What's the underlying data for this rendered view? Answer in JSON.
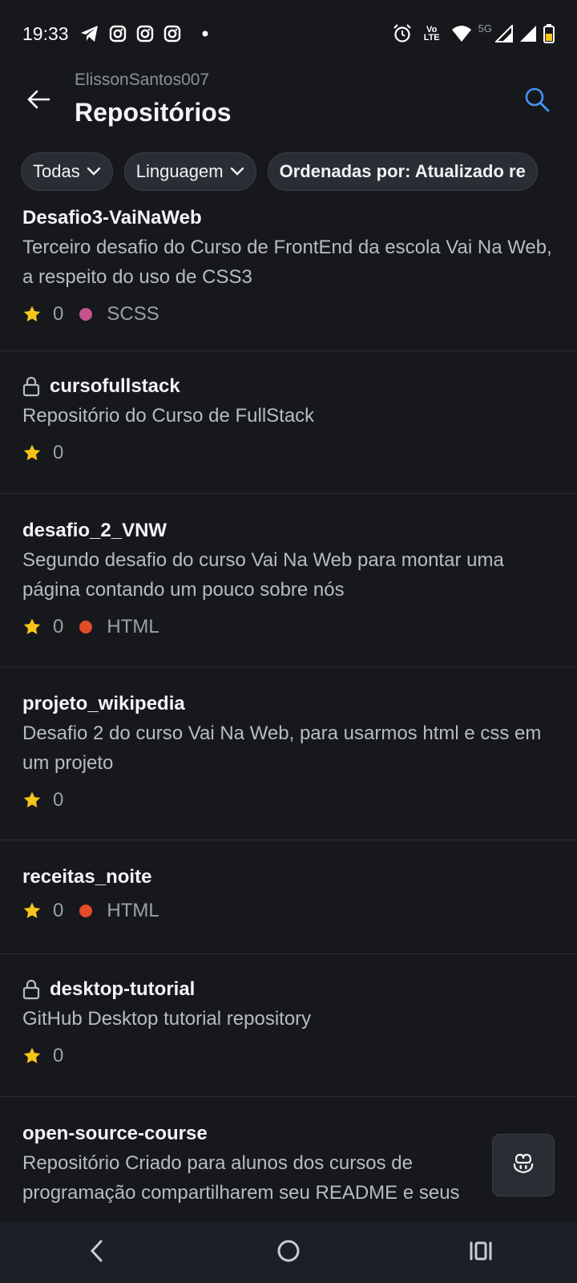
{
  "status_bar": {
    "time": "19:33",
    "left_icons": [
      "telegram-icon",
      "instagram-icon",
      "instagram-icon",
      "instagram-icon",
      "dot-icon"
    ],
    "volte_top": "Vo",
    "volte_bottom": "LTE",
    "network": "5G",
    "right_icons": [
      "alarm-icon",
      "volte-icon",
      "wifi-icon",
      "signal-icon",
      "signal-icon",
      "battery-icon"
    ]
  },
  "header": {
    "owner": "ElissonSantos007",
    "title": "Repositórios"
  },
  "filters": [
    {
      "label": "Todas",
      "has_chevron": true
    },
    {
      "label": "Linguagem",
      "has_chevron": true
    },
    {
      "label": "Ordenadas por: Atualizado re",
      "has_chevron": false
    }
  ],
  "repos": [
    {
      "name": "Desafio3-VaiNaWeb",
      "private": false,
      "description": "Terceiro desafio do Curso de FrontEnd da escola Vai Na Web, a respeito do uso de CSS3",
      "stars": "0",
      "language": "SCSS",
      "language_color": "#c6538c"
    },
    {
      "name": "cursofullstack",
      "private": true,
      "description": "Repositório do Curso de FullStack",
      "stars": "0",
      "language": "",
      "language_color": ""
    },
    {
      "name": "desafio_2_VNW",
      "private": false,
      "description": "Segundo desafio do curso Vai Na Web para montar uma página contando um pouco sobre nós",
      "stars": "0",
      "language": "HTML",
      "language_color": "#e34c26"
    },
    {
      "name": "projeto_wikipedia",
      "private": false,
      "description": "Desafio 2 do curso Vai Na Web, para usarmos html e css em um projeto",
      "stars": "0",
      "language": "",
      "language_color": ""
    },
    {
      "name": "receitas_noite",
      "private": false,
      "description": "",
      "stars": "0",
      "language": "HTML",
      "language_color": "#e34c26"
    },
    {
      "name": "desktop-tutorial",
      "private": true,
      "description": "GitHub Desktop tutorial repository",
      "stars": "0",
      "language": "",
      "language_color": ""
    },
    {
      "name": "open-source-course",
      "private": false,
      "description": "Repositório Criado para alunos dos cursos de programação compartilharem seu README e seus",
      "stars": "",
      "language": "",
      "language_color": ""
    }
  ],
  "colors": {
    "background": "#17181c",
    "star": "#f5c518",
    "accent": "#4493f8"
  }
}
